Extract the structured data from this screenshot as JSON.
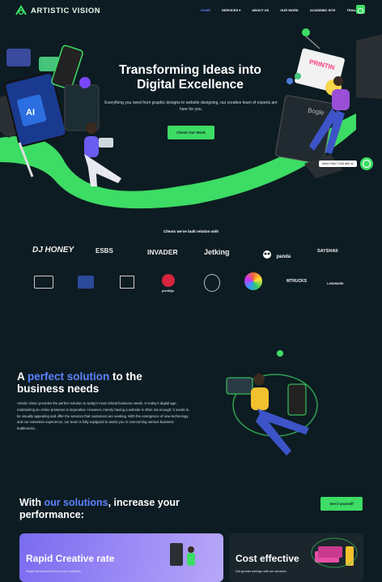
{
  "brand": {
    "name": "ARTISTIC VISION",
    "accent": "#3ddc64",
    "link_accent": "#5c82ff",
    "bg": "#0d1c22"
  },
  "nav": {
    "items": [
      {
        "label": "HOME",
        "active": true
      },
      {
        "label": "SERVICES"
      },
      {
        "label": "ABOUT US"
      },
      {
        "label": "OUR WORK"
      },
      {
        "label": "ACADEMIC SITE"
      },
      {
        "label": "TRIAL"
      }
    ],
    "dropdown_icon": "chevron-down-icon",
    "whatsapp_icon": "whatsapp-icon"
  },
  "hero": {
    "title_line1": "Transforming Ideas into",
    "title_line2": "Digital Excellence",
    "subtitle": "Everything you need from graphic designs to website designing, our creative team of experts are here for you.",
    "cta": "Check Our Work",
    "help_text": "Need Help? Chat with us",
    "illustration_labels": {
      "ai": "AI",
      "print": "PRINTIN",
      "google": "Bogle"
    }
  },
  "clients": {
    "title": "Clients we've built relation with",
    "row1": [
      "DJ HONEY",
      "ESBS",
      "INVADER",
      "Jetking",
      "panda",
      "SAYSHAII"
    ],
    "row2": [
      "",
      "",
      "",
      "prothija",
      "",
      "",
      "MTRUCKS",
      "LANDMARK"
    ]
  },
  "perfect": {
    "title_pre": "A ",
    "title_accent": "perfect solution",
    "title_post": " to the business needs",
    "text": "Artistic Vision provides the perfect solution to today's most critical business needs. In today's digital age, maintaining an online presence is imperative. However, merely having a website is often not enough; it needs to be visually appealing and offer the services that customers are seeking. With the emergence of new technology and our extensive experience, our team is fully equipped to assist you in overcoming serious business bottlenecks."
  },
  "solutions": {
    "title_pre": "With ",
    "title_accent": "our solutions",
    "title_post": ", increase your performance:",
    "cta": "See it yourself",
    "cards": [
      {
        "title": "Rapid Creative rate",
        "sub": "Rapid turnaround times for our creatives."
      },
      {
        "title": "Cost effective",
        "sub": "Get greater savings with our services."
      }
    ]
  }
}
